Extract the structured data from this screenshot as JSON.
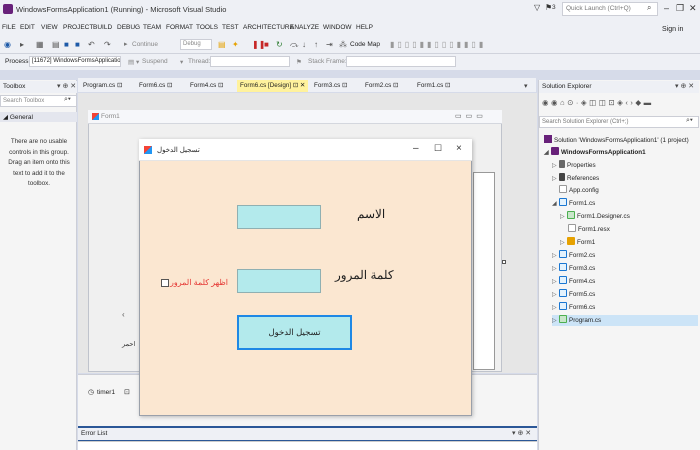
{
  "window": {
    "title": "WindowsFormsApplication1 (Running) - Microsoft Visual Studio",
    "notification_count": "3",
    "quick_launch_placeholder": "Quick Launch (Ctrl+Q)",
    "sign_in": "Sign in",
    "minimize": "–",
    "restore": "❐",
    "close": "✕"
  },
  "menu": [
    "FILE",
    "EDIT",
    "VIEW",
    "PROJECT",
    "BUILD",
    "DEBUG",
    "TEAM",
    "FORMAT",
    "TOOLS",
    "TEST",
    "ARCHITECTURE",
    "ANALYZE",
    "WINDOW",
    "HELP"
  ],
  "toolbar": {
    "continue": "Continue",
    "config": "Debug",
    "code_map": "Code Map",
    "process_label": "Process:",
    "process_value": "[11672] WindowsFormsApplicatio",
    "suspend": "Suspend",
    "thread": "Thread:",
    "stack_frame": "Stack Frame:"
  },
  "toolbox": {
    "title": "Toolbox",
    "search_placeholder": "Search Toolbox",
    "section": "General",
    "empty_message": "There are no usable controls in this group. Drag an item onto this text to add it to the toolbox."
  },
  "tabs": [
    "Program.cs",
    "Form6.cs",
    "Form4.cs",
    "Form6.cs [Design]",
    "Form3.cs",
    "Form2.cs",
    "Form1.cs"
  ],
  "designer": {
    "form_title": "Form1",
    "snippet_label": "احمر",
    "tray_timer": "timer1"
  },
  "error_list": {
    "title": "Error List"
  },
  "solution_explorer": {
    "title": "Solution Explorer",
    "search_placeholder": "Search Solution Explorer (Ctrl+;)",
    "items": [
      {
        "label": "Solution 'WindowsFormsApplication1' (1 project)",
        "icon": "solution-icon"
      },
      {
        "label": "WindowsFormsApplication1",
        "icon": "project-icon"
      },
      {
        "label": "Properties",
        "icon": "properties-icon"
      },
      {
        "label": "References",
        "icon": "references-icon"
      },
      {
        "label": "App.config",
        "icon": "config-file-icon"
      },
      {
        "label": "Form1.cs",
        "icon": "form-icon"
      },
      {
        "label": "Form1.Designer.cs",
        "icon": "csharp-file-icon"
      },
      {
        "label": "Form1.resx",
        "icon": "resx-file-icon"
      },
      {
        "label": "Form1",
        "icon": "class-icon"
      },
      {
        "label": "Form2.cs",
        "icon": "form-icon"
      },
      {
        "label": "Form3.cs",
        "icon": "form-icon"
      },
      {
        "label": "Form4.cs",
        "icon": "form-icon"
      },
      {
        "label": "Form5.cs",
        "icon": "form-icon"
      },
      {
        "label": "Form6.cs",
        "icon": "form-icon"
      },
      {
        "label": "Program.cs",
        "icon": "csharp-file-icon"
      }
    ]
  },
  "login_dialog": {
    "title": "تسجيل الدخول",
    "name_label": "الاسم",
    "password_label": "كلمة المرور",
    "show_password_label": "اظهر كلمة المرور",
    "login_button": "تسجيل الدخول",
    "name_value": "",
    "password_value": ""
  },
  "colors": {
    "dialog_bg": "#fbe7d1",
    "input_bg": "#b3eaec",
    "button_border": "#1e88e5",
    "checkbox_label": "#e53935",
    "active_tab": "#fff29d",
    "vs_accent": "#68217a"
  }
}
